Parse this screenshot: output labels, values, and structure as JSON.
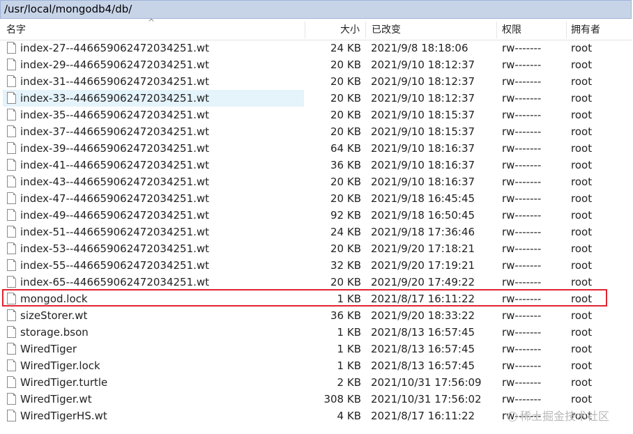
{
  "path": "/usr/local/mongodb4/db/",
  "columns": {
    "name": "名字",
    "size": "大小",
    "modified": "已改变",
    "perms": "权限",
    "owner": "拥有者"
  },
  "hover_row_index": 3,
  "highlight_row_index": 15,
  "highlight_color": "#e0242f",
  "files": [
    {
      "name": "index-27--446659062472034251.wt",
      "size": "24 KB",
      "modified": "2021/9/8 18:18:06",
      "perms": "rw-------",
      "owner": "root"
    },
    {
      "name": "index-29--446659062472034251.wt",
      "size": "20 KB",
      "modified": "2021/9/10 18:12:37",
      "perms": "rw-------",
      "owner": "root"
    },
    {
      "name": "index-31--446659062472034251.wt",
      "size": "20 KB",
      "modified": "2021/9/10 18:12:37",
      "perms": "rw-------",
      "owner": "root"
    },
    {
      "name": "index-33--446659062472034251.wt",
      "size": "20 KB",
      "modified": "2021/9/10 18:12:37",
      "perms": "rw-------",
      "owner": "root"
    },
    {
      "name": "index-35--446659062472034251.wt",
      "size": "20 KB",
      "modified": "2021/9/10 18:15:37",
      "perms": "rw-------",
      "owner": "root"
    },
    {
      "name": "index-37--446659062472034251.wt",
      "size": "20 KB",
      "modified": "2021/9/10 18:15:37",
      "perms": "rw-------",
      "owner": "root"
    },
    {
      "name": "index-39--446659062472034251.wt",
      "size": "64 KB",
      "modified": "2021/9/10 18:16:37",
      "perms": "rw-------",
      "owner": "root"
    },
    {
      "name": "index-41--446659062472034251.wt",
      "size": "36 KB",
      "modified": "2021/9/10 18:16:37",
      "perms": "rw-------",
      "owner": "root"
    },
    {
      "name": "index-43--446659062472034251.wt",
      "size": "20 KB",
      "modified": "2021/9/10 18:16:37",
      "perms": "rw-------",
      "owner": "root"
    },
    {
      "name": "index-47--446659062472034251.wt",
      "size": "20 KB",
      "modified": "2021/9/18 16:45:45",
      "perms": "rw-------",
      "owner": "root"
    },
    {
      "name": "index-49--446659062472034251.wt",
      "size": "92 KB",
      "modified": "2021/9/18 16:50:45",
      "perms": "rw-------",
      "owner": "root"
    },
    {
      "name": "index-51--446659062472034251.wt",
      "size": "24 KB",
      "modified": "2021/9/18 17:36:46",
      "perms": "rw-------",
      "owner": "root"
    },
    {
      "name": "index-53--446659062472034251.wt",
      "size": "20 KB",
      "modified": "2021/9/20 17:18:21",
      "perms": "rw-------",
      "owner": "root"
    },
    {
      "name": "index-55--446659062472034251.wt",
      "size": "32 KB",
      "modified": "2021/9/20 17:19:21",
      "perms": "rw-------",
      "owner": "root"
    },
    {
      "name": "index-65--446659062472034251.wt",
      "size": "20 KB",
      "modified": "2021/9/20 17:49:22",
      "perms": "rw-------",
      "owner": "root"
    },
    {
      "name": "mongod.lock",
      "size": "1 KB",
      "modified": "2021/8/17 16:11:22",
      "perms": "rw-------",
      "owner": "root"
    },
    {
      "name": "sizeStorer.wt",
      "size": "36 KB",
      "modified": "2021/9/20 18:33:22",
      "perms": "rw-------",
      "owner": "root"
    },
    {
      "name": "storage.bson",
      "size": "1 KB",
      "modified": "2021/8/13 16:57:45",
      "perms": "rw-------",
      "owner": "root"
    },
    {
      "name": "WiredTiger",
      "size": "1 KB",
      "modified": "2021/8/13 16:57:45",
      "perms": "rw-------",
      "owner": "root"
    },
    {
      "name": "WiredTiger.lock",
      "size": "1 KB",
      "modified": "2021/8/13 16:57:45",
      "perms": "rw-------",
      "owner": "root"
    },
    {
      "name": "WiredTiger.turtle",
      "size": "2 KB",
      "modified": "2021/10/31 17:56:09",
      "perms": "rw-------",
      "owner": "root"
    },
    {
      "name": "WiredTiger.wt",
      "size": "308 KB",
      "modified": "2021/10/31 17:56:02",
      "perms": "rw-------",
      "owner": "root"
    },
    {
      "name": "WiredTigerHS.wt",
      "size": "4 KB",
      "modified": "2021/8/17 16:11:22",
      "perms": "rw-------",
      "owner": "root"
    }
  ],
  "watermark": "稀土掘金技术社区"
}
